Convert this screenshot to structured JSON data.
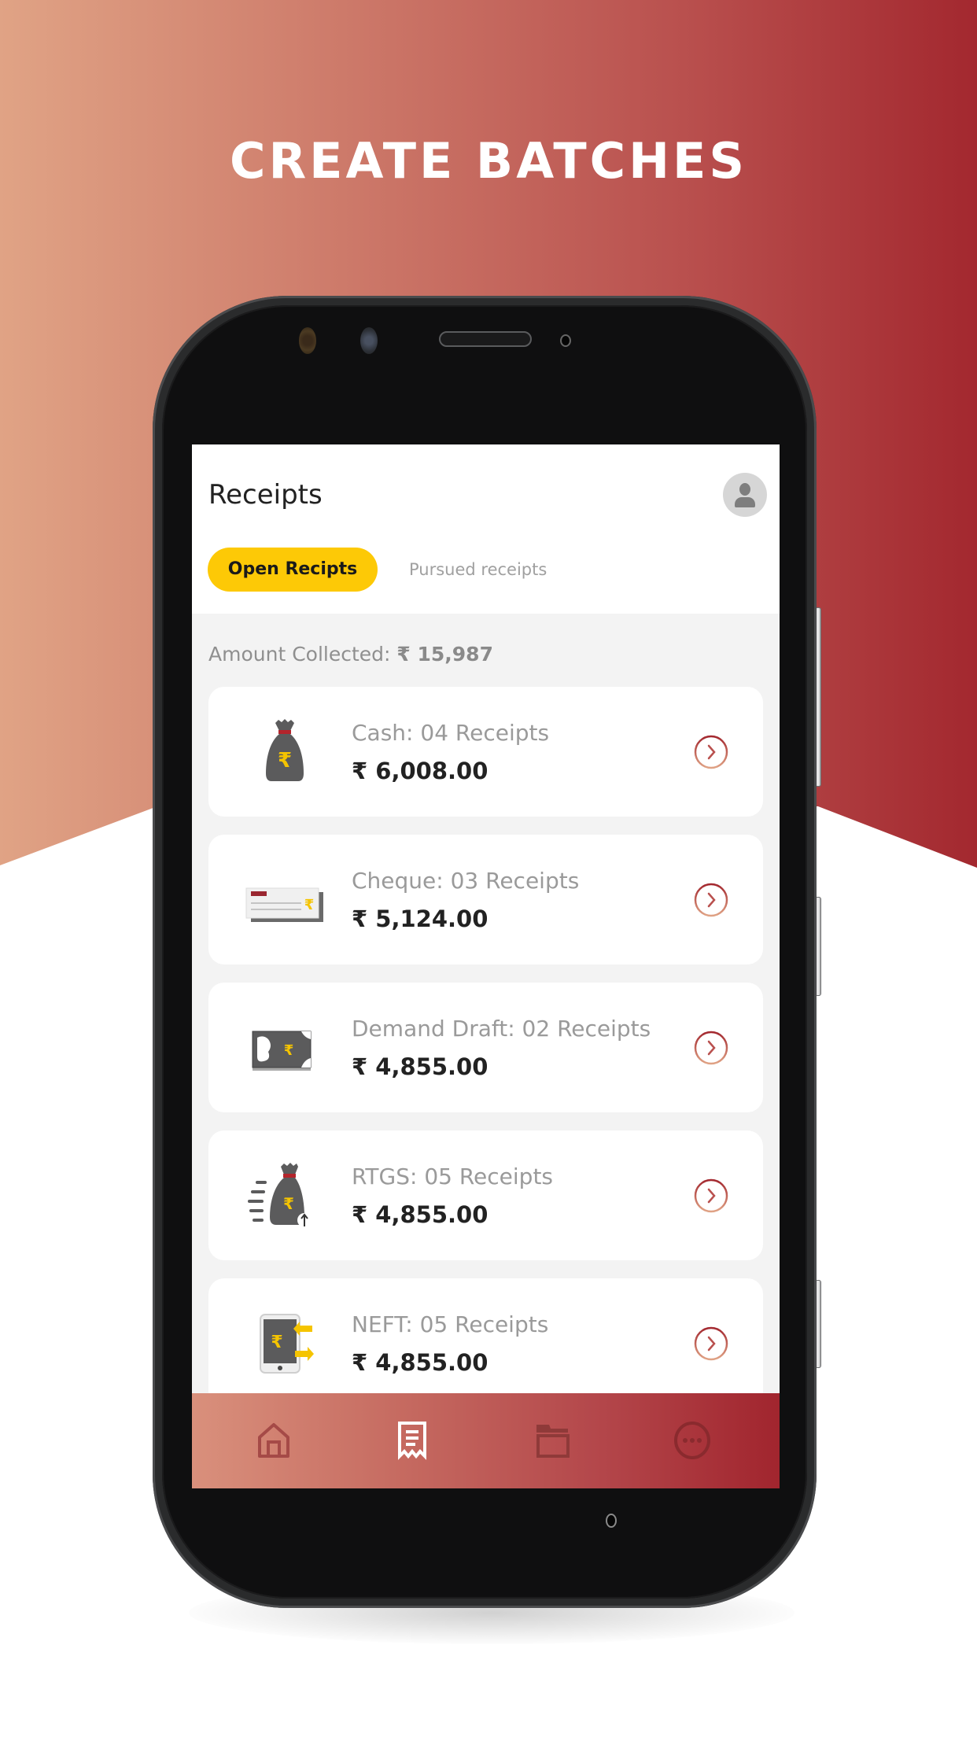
{
  "promo": {
    "headline": "CREATE BATCHES",
    "gradient_colors": [
      "#e0a385",
      "#cd7a6a",
      "#b9504e",
      "#a3282f"
    ]
  },
  "app": {
    "title": "Receipts",
    "avatar_icon": "user-avatar-icon",
    "tabs": [
      {
        "label": "Open Recipts",
        "active": true
      },
      {
        "label": "Pursued receipts",
        "active": false
      }
    ],
    "accent_color": "#fdc906",
    "amount_collected": {
      "label": "Amount Collected:",
      "value": "₹ 15,987"
    },
    "receipt_groups": [
      {
        "icon": "money-bag-icon",
        "label": "Cash: 04 Receipts",
        "amount": "₹ 6,008.00"
      },
      {
        "icon": "cheque-icon",
        "label": "Cheque: 03 Receipts",
        "amount": "₹ 5,124.00"
      },
      {
        "icon": "demand-draft-icon",
        "label": "Demand Draft: 02 Receipts",
        "amount": "₹ 4,855.00"
      },
      {
        "icon": "rtgs-transfer-icon",
        "label": "RTGS: 05 Receipts",
        "amount": "₹ 4,855.00"
      },
      {
        "icon": "neft-mobile-transfer-icon",
        "label": "NEFT: 05 Receipts",
        "amount": "₹ 4,855.00"
      }
    ],
    "bottom_nav": [
      {
        "icon": "home-icon",
        "active": false
      },
      {
        "icon": "receipt-icon",
        "active": true
      },
      {
        "icon": "folder-icon",
        "active": false
      },
      {
        "icon": "more-icon",
        "active": false
      }
    ]
  }
}
